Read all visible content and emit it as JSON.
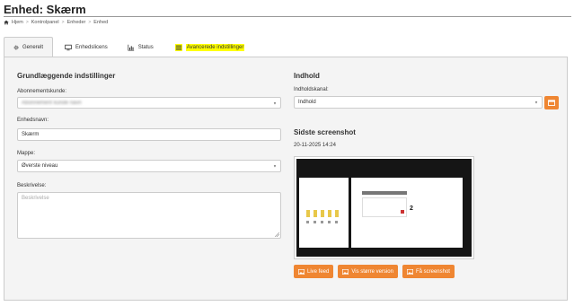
{
  "page": {
    "title": "Enhed: Skærm"
  },
  "breadcrumb": {
    "items": [
      "Hjem",
      "Kontrolpanel",
      "Enheder",
      "Enhed"
    ],
    "separator": ">"
  },
  "tabs": [
    {
      "label": "Generelt",
      "icon": "gear-icon",
      "active": true
    },
    {
      "label": "Enhedslicens",
      "icon": "monitor-icon",
      "active": false
    },
    {
      "label": "Status",
      "icon": "bar-chart-icon",
      "active": false
    },
    {
      "label": "Avancerede indstillinger",
      "icon": "list-icon",
      "active": false,
      "highlighted": true
    }
  ],
  "basic": {
    "title": "Grundlæggende indstillinger",
    "subscription_label": "Abonnementskunde:",
    "subscription_value": "Abonnement kunde navn",
    "name_label": "Enhedsnavn:",
    "name_value": "Skærm",
    "folder_label": "Mappe:",
    "folder_value": "Øverste niveau",
    "description_label": "Beskrivelse:",
    "description_placeholder": "Beskrivelse"
  },
  "content": {
    "title": "Indhold",
    "channel_label": "Indholdskanal:",
    "channel_value": "Indhold"
  },
  "screenshot": {
    "title": "Sidste screenshot",
    "timestamp": "20-11-2025 14:24",
    "overlay_number": "2"
  },
  "buttons": {
    "live_feed": "Live feed",
    "larger_version": "Vis større version",
    "get_screenshot": "Få screenshot"
  },
  "colors": {
    "accent": "#ef8632",
    "highlight": "#ffff00",
    "panel_bg": "#f4f4f4"
  }
}
